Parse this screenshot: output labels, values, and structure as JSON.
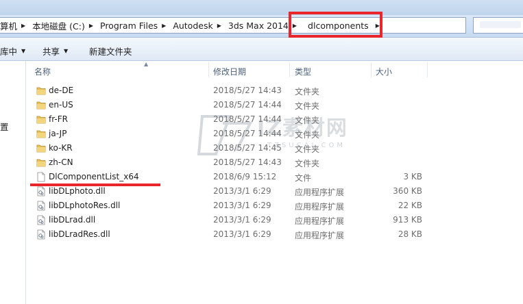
{
  "breadcrumb": {
    "items": [
      {
        "label": "算机"
      },
      {
        "label": "本地磁盘 (C:)"
      },
      {
        "label": "Program Files"
      },
      {
        "label": "Autodesk"
      },
      {
        "label": "3ds Max 2014"
      },
      {
        "label": "dlcomponents"
      }
    ]
  },
  "toolbar": {
    "include_label": "库中",
    "share_label": "共享",
    "new_folder_label": "新建文件夹"
  },
  "navpane": {
    "partial_text": "置"
  },
  "columns": {
    "name": "名称",
    "date": "修改日期",
    "type": "类型",
    "size": "大小"
  },
  "files": [
    {
      "name": "de-DE",
      "date": "2018/5/27 14:43",
      "type": "文件夹",
      "size": "",
      "icon": "folder-icon"
    },
    {
      "name": "en-US",
      "date": "2018/5/27 14:44",
      "type": "文件夹",
      "size": "",
      "icon": "folder-icon"
    },
    {
      "name": "fr-FR",
      "date": "2018/5/27 14:44",
      "type": "文件夹",
      "size": "",
      "icon": "folder-icon"
    },
    {
      "name": "ja-JP",
      "date": "2018/5/27 14:44",
      "type": "文件夹",
      "size": "",
      "icon": "folder-icon"
    },
    {
      "name": "ko-KR",
      "date": "2018/5/27 14:45",
      "type": "文件夹",
      "size": "",
      "icon": "folder-icon"
    },
    {
      "name": "zh-CN",
      "date": "2018/5/27 14:43",
      "type": "文件夹",
      "size": "",
      "icon": "folder-icon"
    },
    {
      "name": "DlComponentList_x64",
      "date": "2018/6/9 15:12",
      "type": "文件",
      "size": "3 KB",
      "icon": "file-icon"
    },
    {
      "name": "libDLphoto.dll",
      "date": "2013/3/1 6:29",
      "type": "应用程序扩展",
      "size": "360 KB",
      "icon": "dll-file-icon"
    },
    {
      "name": "libDLphotoRes.dll",
      "date": "2013/3/1 6:29",
      "type": "应用程序扩展",
      "size": "22 KB",
      "icon": "dll-file-icon"
    },
    {
      "name": "libDLrad.dll",
      "date": "2013/3/1 6:29",
      "type": "应用程序扩展",
      "size": "913 KB",
      "icon": "dll-file-icon"
    },
    {
      "name": "libDLradRes.dll",
      "date": "2013/3/1 6:29",
      "type": "应用程序扩展",
      "size": "28 KB",
      "icon": "dll-file-icon"
    }
  ],
  "watermark": {
    "text": "IZ素材网",
    "sub": "TZSUCAI.COM"
  },
  "colors": {
    "annotation_red": "#e8262c",
    "folder_yellow": "#e9c25a"
  }
}
